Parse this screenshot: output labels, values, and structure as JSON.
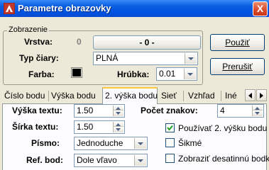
{
  "window": {
    "title": "Parametre obrazovky",
    "close_label": "X"
  },
  "group": {
    "legend": "Zobrazenie",
    "layer_label": "Vrstva:",
    "layer_value": "0",
    "layer_name": "- 0 -",
    "line_type_label": "Typ čiary:",
    "line_type_value": "PLNÁ",
    "color_label": "Farba:",
    "color_hex": "#000000",
    "thickness_label": "Hrúbka:",
    "thickness_value": "0.01"
  },
  "buttons": {
    "apply": "Použiť",
    "cancel": "Prerušiť"
  },
  "tabs": [
    {
      "label": "Číslo bodu"
    },
    {
      "label": "Výška bodu"
    },
    {
      "label": "2. výška bodu",
      "active": true
    },
    {
      "label": "Sieť"
    },
    {
      "label": "Vzhľad"
    },
    {
      "label": "Iné"
    }
  ],
  "panel": {
    "text_height_label": "Výška textu:",
    "text_height_value": "1.50",
    "text_width_label": "Šírka textu:",
    "text_width_value": "1.50",
    "font_label": "Písmo:",
    "font_value": "Jednoduche",
    "ref_point_label": "Ref. bod:",
    "ref_point_value": "Dole vľavo",
    "char_count_label": "Počet znakov:",
    "char_count_value": "4",
    "use_second_height_label": "Používať 2. výšku bodu",
    "use_second_height_checked": true,
    "oblique_label": "Šikmé",
    "oblique_checked": false,
    "show_decimal_point_label": "Zobraziť desatinnú bodku",
    "show_decimal_point_checked": false
  },
  "colors": {
    "titlebar": "#0054e3",
    "dialog_bg": "#ece9d8",
    "tab_highlight": "#ffc83c"
  }
}
